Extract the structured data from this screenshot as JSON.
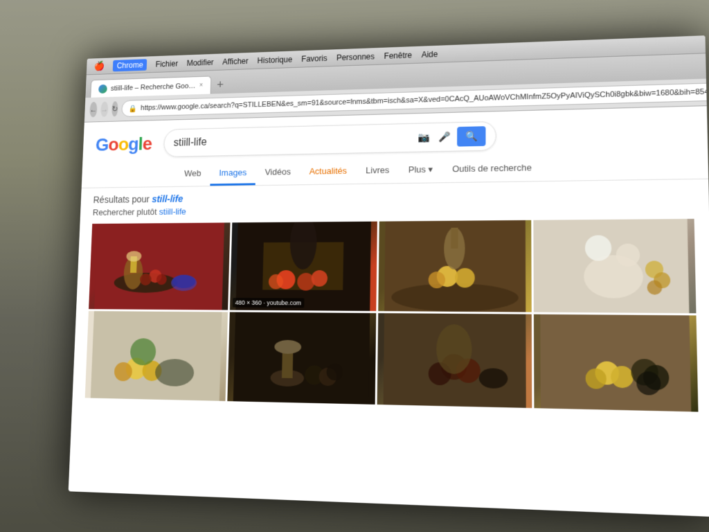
{
  "monitor": {
    "background": "dark laptop frame with room background"
  },
  "mac_menubar": {
    "apple": "🍎",
    "items": [
      "Chrome",
      "Fichier",
      "Modifier",
      "Afficher",
      "Historique",
      "Favoris",
      "Personnes",
      "Fenêtre",
      "Aide"
    ]
  },
  "browser": {
    "tab": {
      "title": "stiill-life – Recherche Goo…",
      "close": "×"
    },
    "tab_new": "+",
    "address_bar": {
      "back": "←",
      "forward": "→",
      "reload": "↻",
      "url": "https://www.google.ca/search?q=STILLEBEN&es_sm=91&source=lnms&tbm=isch&sa=X&ved=0CAcQ_AUoAWoVChMInfmZ5OyPyAIViQySCh0i8gbk&biw=1680&bih=854"
    }
  },
  "google": {
    "logo": {
      "G": "G",
      "o1": "o",
      "o2": "o",
      "g": "g",
      "l": "l",
      "e": "e"
    },
    "search_query": "stiill-life",
    "search_placeholder": "stiill-life",
    "nav_tabs": [
      {
        "label": "Web",
        "active": false
      },
      {
        "label": "Images",
        "active": true
      },
      {
        "label": "Vidéos",
        "active": false
      },
      {
        "label": "Actualités",
        "active": false,
        "color": "orange"
      },
      {
        "label": "Livres",
        "active": false
      },
      {
        "label": "Plus ▾",
        "active": false
      },
      {
        "label": "Outils de recherche",
        "active": false
      }
    ],
    "results_for_label": "Résultats pour ",
    "results_for_link": "still-life",
    "suggest_label": "Rechercher plutôt ",
    "suggest_link": "stiill-life",
    "images": [
      {
        "id": 1,
        "label": "",
        "class": "img-1"
      },
      {
        "id": 2,
        "label": "480 × 360 · youtube.com",
        "class": "img-2"
      },
      {
        "id": 3,
        "label": "",
        "class": "img-3"
      },
      {
        "id": 4,
        "label": "",
        "class": "img-4"
      },
      {
        "id": 5,
        "label": "",
        "class": "img-5"
      },
      {
        "id": 6,
        "label": "",
        "class": "img-6"
      },
      {
        "id": 7,
        "label": "",
        "class": "img-7"
      },
      {
        "id": 8,
        "label": "",
        "class": "img-8"
      },
      {
        "id": 9,
        "label": "",
        "class": "img-9"
      },
      {
        "id": 10,
        "label": "",
        "class": "img-10"
      },
      {
        "id": 11,
        "label": "",
        "class": "img-11"
      },
      {
        "id": 12,
        "label": "",
        "class": "img-12"
      }
    ]
  }
}
